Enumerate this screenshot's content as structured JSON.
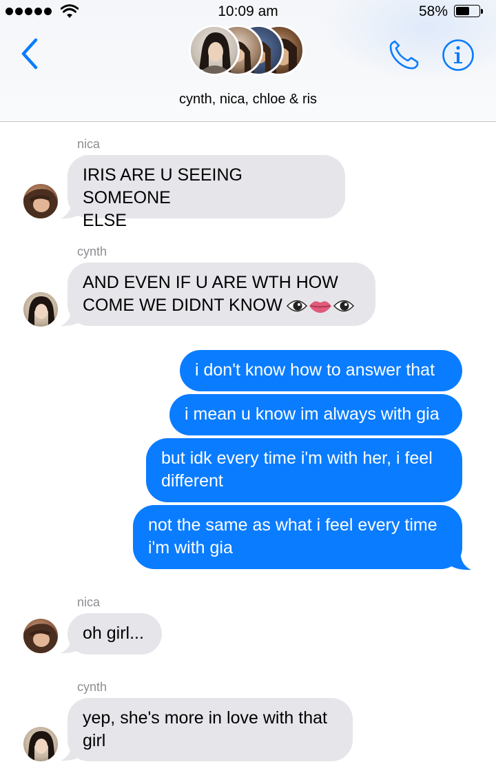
{
  "status_bar": {
    "time": "10:09 am",
    "battery_percent": "58%",
    "battery_level": 0.58,
    "signal_dots": 5
  },
  "header": {
    "group_name": "cynth, nica, chloe & ris",
    "back_icon": "chevron-left-icon",
    "call_icon": "phone-icon",
    "info_icon": "info-icon"
  },
  "colors": {
    "accent": "#0a7cff",
    "incoming_bubble": "#e5e5ea",
    "sender_label": "#8e8e93"
  },
  "messages": [
    {
      "sender": "nica",
      "text": "IRIS ARE U SEEING SOMEONE ELSE",
      "line1": "IRIS ARE U SEEING SOMEONE",
      "line2": "ELSE",
      "direction": "incoming"
    },
    {
      "sender": "cynth",
      "text": "AND EVEN IF U ARE WTH HOW COME WE DIDNT KNOW 👁👄👁",
      "line1": "AND EVEN IF U ARE WTH HOW",
      "line2": "COME WE DIDNT KNOW",
      "emoji": [
        "eye",
        "lips",
        "eye"
      ],
      "direction": "incoming"
    },
    {
      "sender": "me",
      "text": "i don't know how to answer that",
      "direction": "outgoing"
    },
    {
      "sender": "me",
      "text": "i mean u know im always with gia",
      "direction": "outgoing"
    },
    {
      "sender": "me",
      "text": "but idk every time i'm with her, i feel different",
      "line1": "but idk every time i'm with her, i feel",
      "line2": "different",
      "direction": "outgoing"
    },
    {
      "sender": "me",
      "text": "not the same as what i feel every time i'm with gia",
      "line1": "not the same as what i feel every time",
      "line2": "i'm with gia",
      "direction": "outgoing"
    },
    {
      "sender": "nica",
      "text": "oh girl...",
      "direction": "incoming"
    },
    {
      "sender": "cynth",
      "text": "yep, she's more in love with that girl",
      "line1": "yep, she's more in love with that",
      "line2": "girl",
      "direction": "incoming"
    }
  ]
}
